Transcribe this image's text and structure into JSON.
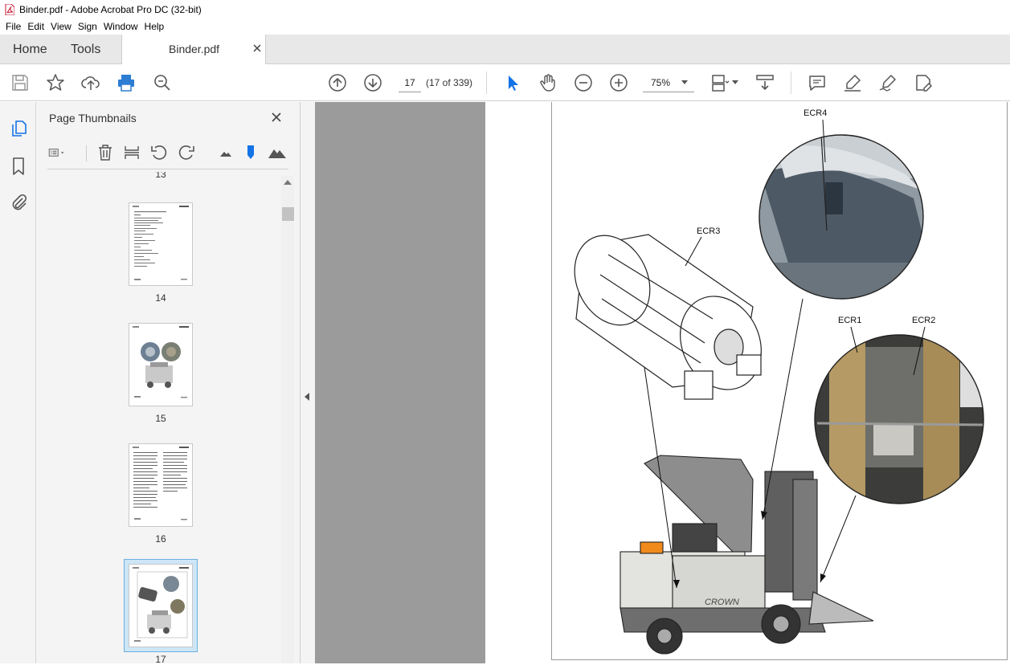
{
  "window": {
    "title": "Binder.pdf - Adobe Acrobat Pro DC (32-bit)"
  },
  "menu": [
    "File",
    "Edit",
    "View",
    "Sign",
    "Window",
    "Help"
  ],
  "tabs": {
    "home": "Home",
    "tools": "Tools",
    "document": "Binder.pdf"
  },
  "toolbar": {
    "page_value": "17",
    "page_count": "(17 of 339)",
    "zoom": "75%",
    "icons": [
      "save-icon",
      "star-icon",
      "upload-icon",
      "print-icon",
      "search-zoom-icon",
      "previous-page-icon",
      "next-page-icon",
      "select-cursor-icon",
      "hand-icon",
      "zoom-out-icon",
      "zoom-in-icon",
      "fit-page-icon",
      "scroll-mode-icon",
      "comment-icon",
      "highlight-icon",
      "sign-icon",
      "fill-sign-icon"
    ]
  },
  "left_rail": [
    "page-thumbnails-icon",
    "bookmark-icon",
    "attachment-icon"
  ],
  "thumbnail_panel": {
    "title": "Page Thumbnails",
    "tools": [
      "options-menu-icon",
      "delete-icon",
      "insert-icon",
      "rotate-left-icon",
      "rotate-right-icon",
      "small-mountain-icon",
      "slider-marker-icon",
      "large-mountain-icon"
    ],
    "pages": [
      {
        "number": "13",
        "kind": "partial"
      },
      {
        "number": "14",
        "kind": "text"
      },
      {
        "number": "15",
        "kind": "image"
      },
      {
        "number": "16",
        "kind": "two-column-text"
      },
      {
        "number": "17",
        "kind": "image",
        "selected": true
      }
    ]
  },
  "page_content": {
    "callouts": [
      "ECR4",
      "ECR3",
      "ECR1",
      "ECR2"
    ],
    "truck_brand": "CROWN"
  },
  "colors": {
    "accent_blue": "#1473e6",
    "print_blue": "#2d7dd2",
    "doc_gray": "#9b9b9b",
    "thumb_selected": "#cde6f7"
  }
}
